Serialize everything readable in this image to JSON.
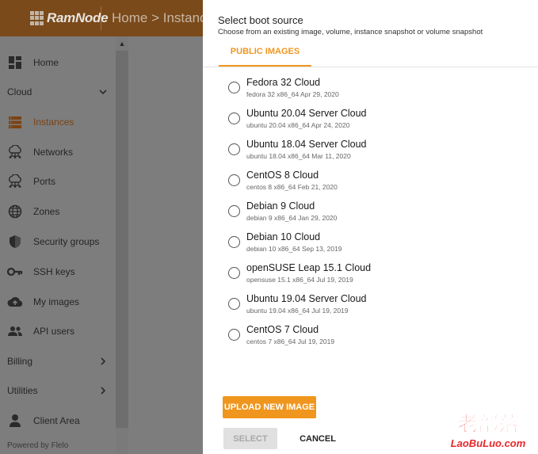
{
  "header": {
    "logo_text": "RamNode",
    "breadcrumb": "Home > Instance"
  },
  "sidebar": {
    "items": [
      {
        "label": "Home",
        "icon": "dashboard-icon"
      },
      {
        "section": "Cloud",
        "expanded": true
      },
      {
        "label": "Instances",
        "icon": "instances-icon",
        "active": true
      },
      {
        "label": "Networks",
        "icon": "network-cloud-icon"
      },
      {
        "label": "Ports",
        "icon": "ports-cloud-icon"
      },
      {
        "label": "Zones",
        "icon": "globe-icon"
      },
      {
        "label": "Security groups",
        "icon": "shield-icon"
      },
      {
        "label": "SSH keys",
        "icon": "key-icon"
      },
      {
        "label": "My images",
        "icon": "cloud-upload-icon"
      },
      {
        "label": "API users",
        "icon": "users-icon"
      },
      {
        "section": "Billing",
        "expanded": false
      },
      {
        "section": "Utilities",
        "expanded": false
      },
      {
        "label": "Client Area",
        "icon": "person-icon"
      }
    ],
    "footer": "Powered by Flelo"
  },
  "dialog": {
    "title": "Select boot source",
    "subtitle": "Choose from an existing image, volume, instance snapshot or volume snapshot",
    "tab": "PUBLIC IMAGES",
    "options": [
      {
        "name": "Fedora 32 Cloud",
        "desc": "fedora 32 x86_64 Apr 29, 2020"
      },
      {
        "name": "Ubuntu 20.04 Server Cloud",
        "desc": "ubuntu 20.04 x86_64 Apr 24, 2020"
      },
      {
        "name": "Ubuntu 18.04 Server Cloud",
        "desc": "ubuntu 18.04 x86_64 Mar 11, 2020"
      },
      {
        "name": "CentOS 8 Cloud",
        "desc": "centos 8 x86_64 Feb 21, 2020"
      },
      {
        "name": "Debian 9 Cloud",
        "desc": "debian 9 x86_64 Jan 29, 2020"
      },
      {
        "name": "Debian 10 Cloud",
        "desc": "debian 10 x86_64 Sep 13, 2019"
      },
      {
        "name": "openSUSE Leap 15.1 Cloud",
        "desc": "opensuse 15.1 x86_64 Jul 19, 2019"
      },
      {
        "name": "Ubuntu 19.04 Server Cloud",
        "desc": "ubuntu 19.04 x86_64 Jul 19, 2019"
      },
      {
        "name": "CentOS 7 Cloud",
        "desc": "centos 7 x86_64 Jul 19, 2019"
      }
    ],
    "upload_label": "UPLOAD NEW IMAGE",
    "select_label": "SELECT",
    "cancel_label": "CANCEL"
  },
  "watermark": {
    "cn": "老部落",
    "url": "LaoBuLuo.com"
  },
  "colors": {
    "accent": "#f0961e",
    "header_dimmed": "#7a4a1a",
    "overlay_gray": "#7d7d7d",
    "watermark_red": "#e8262b"
  }
}
